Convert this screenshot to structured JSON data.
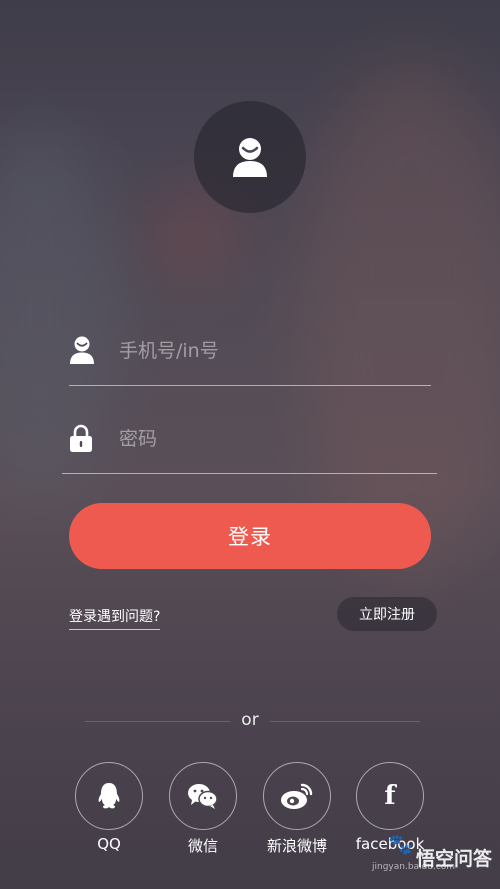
{
  "login_form": {
    "username_placeholder": "手机号/in号",
    "password_placeholder": "密码",
    "submit_label": "登录",
    "trouble_link": "登录遇到问题?",
    "register_label": "立即注册"
  },
  "divider": {
    "label": "or"
  },
  "social_login": [
    {
      "label": "QQ",
      "icon": "qq-icon"
    },
    {
      "label": "微信",
      "icon": "wechat-icon"
    },
    {
      "label": "新浪微博",
      "icon": "weibo-icon"
    },
    {
      "label": "facebook",
      "icon": "facebook-icon"
    }
  ],
  "watermark": {
    "text": "悟空问答",
    "url": "jingyan.baidu.com"
  },
  "colors": {
    "accent": "#ee5a4f",
    "background": "#4a4552"
  }
}
